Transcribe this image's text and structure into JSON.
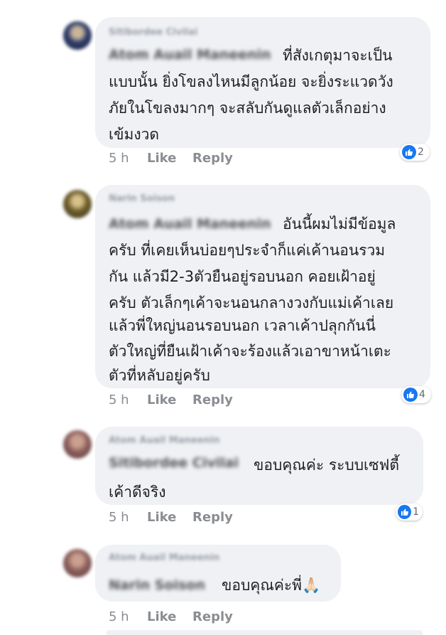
{
  "comments": [
    {
      "author": "Sitibordee Civilai",
      "tag": "Atom Auail Maneenin",
      "lines": [
        "ที่สังเกตุมาจะเป็น",
        "แบบนั้น ยิ่งโขลงไหนมีลูกน้อย จะยิ่งระแวดวัง",
        "ภัยในโขลงมากๆ จะสลับกันดูแลตัวเล็กอย่าง",
        "เข้มงวด"
      ],
      "time": "5 h",
      "like_label": "Like",
      "reply_label": "Reply",
      "reaction_count": "2",
      "avatar_color": "#3a4b7a"
    },
    {
      "author": "Narin Soison",
      "tag": "Atom Auail Maneenin",
      "lines": [
        "อันนี้ผมไม่มีข้อมูล",
        "ครับ ที่เคยเห็นบ่อยๆประจำก็แค่เค้านอนรวม",
        "กัน แล้วมี2-3ตัวยืนอยู่รอบนอก คอยเฝ้าอยู่",
        "ครับ ตัวเล็กๆเค้าจะนอนกลางวงกับแม่เค้าเลย",
        "แล้วพี่ใหญ่นอนรอบนอก เวลาเค้าปลุกกันนี่",
        "ตัวใหญ่ที่ยืนเฝ้าเค้าจะร้องแล้วเอาขาหน้าเตะ",
        "ตัวที่หลับอยู่ครับ"
      ],
      "time": "5 h",
      "like_label": "Like",
      "reply_label": "Reply",
      "reaction_count": "4",
      "avatar_color": "#7a6a3a"
    },
    {
      "author": "Atom Auail Maneenin",
      "tag": "Sitibordee Civilai",
      "lines": [
        "ขอบคุณค่ะ ระบบเซฟตี้",
        "เค้าดีจริง"
      ],
      "time": "5 h",
      "like_label": "Like",
      "reply_label": "Reply",
      "reaction_count": "1",
      "avatar_color": "#8a6a6a"
    },
    {
      "author": "Atom Auail Maneenin",
      "tag": "Narin Soison",
      "lines": [
        "ขอบคุณค่ะพี่🙏🏻"
      ],
      "time": "5 h",
      "like_label": "Like",
      "reply_label": "Reply",
      "reaction_count": "",
      "avatar_color": "#8a6a6a"
    }
  ],
  "colors": {
    "bubble": "#eff1f4",
    "like_blue": "#1877f2",
    "meta_gray": "#8a8d91"
  }
}
